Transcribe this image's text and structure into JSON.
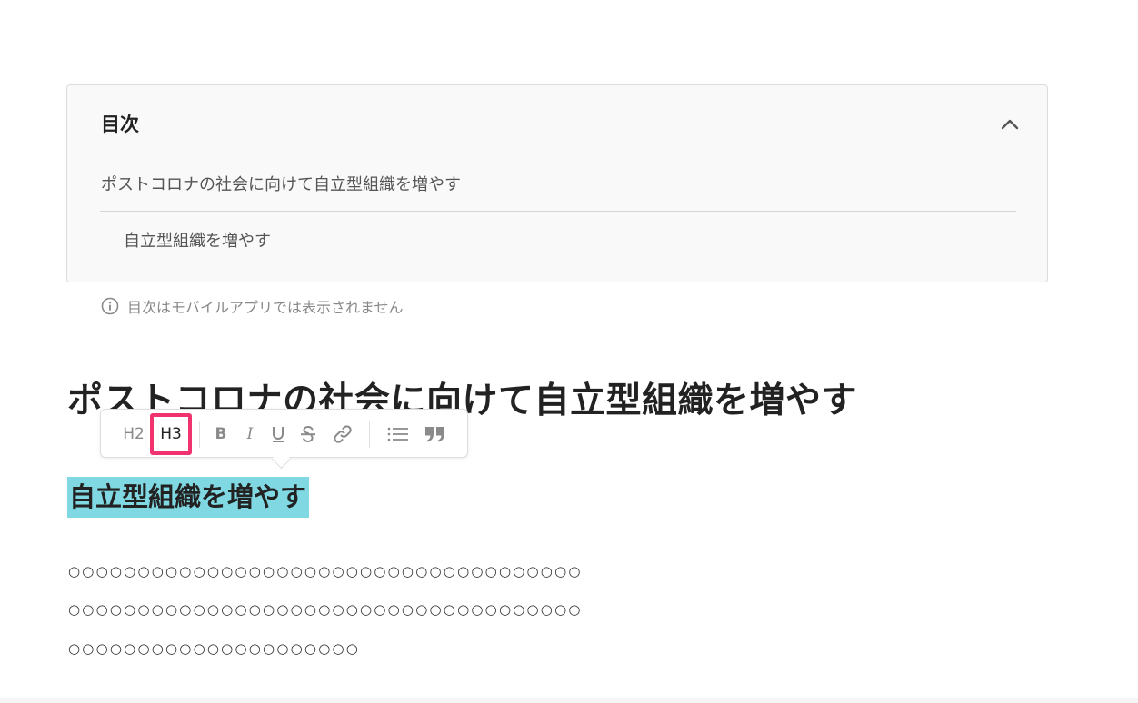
{
  "toc": {
    "title": "目次",
    "items": [
      {
        "label": "ポストコロナの社会に向けて自立型組織を増やす",
        "level": 2
      },
      {
        "label": "自立型組織を増やす",
        "level": 3
      }
    ],
    "toggle_icon": "chevron-up-icon",
    "notice": "目次はモバイルアプリでは表示されません",
    "notice_icon": "info-icon"
  },
  "editor": {
    "heading_h2": "ポストコロナの社会に向けて自立型組織を増やす",
    "heading_h3_selected": "自立型組織を増やす",
    "selection_color": "#7fd8e2",
    "body_lines": [
      "○○○○○○○○○○○○○○○○○○○○○○○○○○○○○○○○○○○○○",
      "○○○○○○○○○○○○○○○○○○○○○○○○○○○○○○○○○○○○○",
      "○○○○○○○○○○○○○○○○○○○○○"
    ]
  },
  "toolbar": {
    "h2_label": "H2",
    "h3_label": "H3",
    "h3_highlight_color": "#f0326e",
    "bold_label": "B",
    "italic_label": "I",
    "underline_icon": "underline-icon",
    "strikethrough_icon": "strikethrough-icon",
    "link_icon": "link-icon",
    "list_icon": "bulleted-list-icon",
    "quote_icon": "quote-icon"
  }
}
